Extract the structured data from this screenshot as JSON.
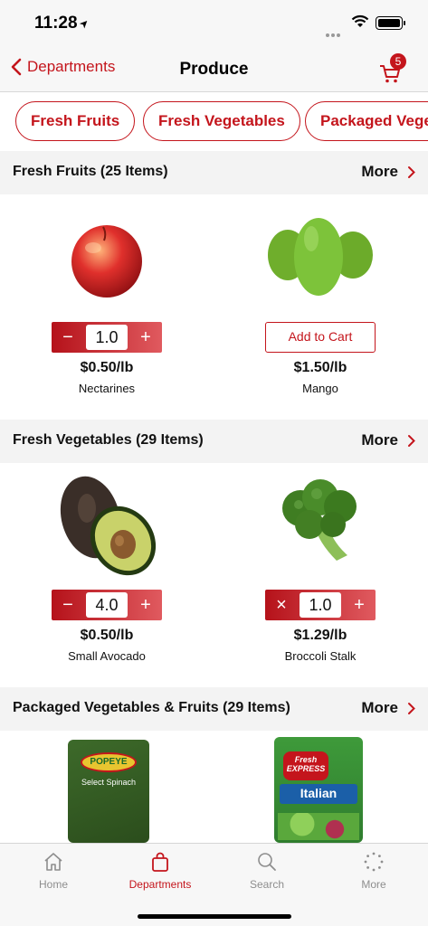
{
  "status": {
    "time": "11:28",
    "location_glyph": "➤"
  },
  "nav": {
    "back_label": "Departments",
    "title": "Produce",
    "cart_count": "5"
  },
  "chips": [
    "Fresh Fruits",
    "Fresh Vegetables",
    "Packaged Vegetables & Fruits"
  ],
  "sections": [
    {
      "title": "Fresh Fruits (25 Items)",
      "more_label": "More",
      "products": [
        {
          "name": "Nectarines",
          "price": "$0.50/lb",
          "qty": "1.0",
          "control": "stepper",
          "left_btn": "−",
          "right_btn": "+"
        },
        {
          "name": "Mango",
          "price": "$1.50/lb",
          "control": "add",
          "add_label": "Add to Cart"
        }
      ]
    },
    {
      "title": "Fresh Vegetables (29 Items)",
      "more_label": "More",
      "products": [
        {
          "name": "Small Avocado",
          "price": "$0.50/lb",
          "qty": "4.0",
          "control": "stepper",
          "left_btn": "−",
          "right_btn": "+"
        },
        {
          "name": "Broccoli Stalk",
          "price": "$1.29/lb",
          "qty": "1.0",
          "control": "stepper",
          "left_btn": "×",
          "right_btn": "+"
        }
      ]
    },
    {
      "title": "Packaged Vegetables & Fruits (29 Items)",
      "more_label": "More",
      "products": [
        {
          "package_brand": "POPEYE",
          "package_text": "Select Spinach"
        },
        {
          "package_brand": "Fresh EXPRESS",
          "package_text": "Italian"
        }
      ]
    }
  ],
  "tabs": [
    {
      "label": "Home",
      "icon": "home-icon",
      "active": false
    },
    {
      "label": "Departments",
      "icon": "bag-icon",
      "active": true
    },
    {
      "label": "Search",
      "icon": "search-icon",
      "active": false
    },
    {
      "label": "More",
      "icon": "more-icon",
      "active": false
    }
  ],
  "colors": {
    "accent": "#c4151c",
    "header_bg": "#f3f3f3",
    "bar_bg": "#f7f7f7"
  }
}
